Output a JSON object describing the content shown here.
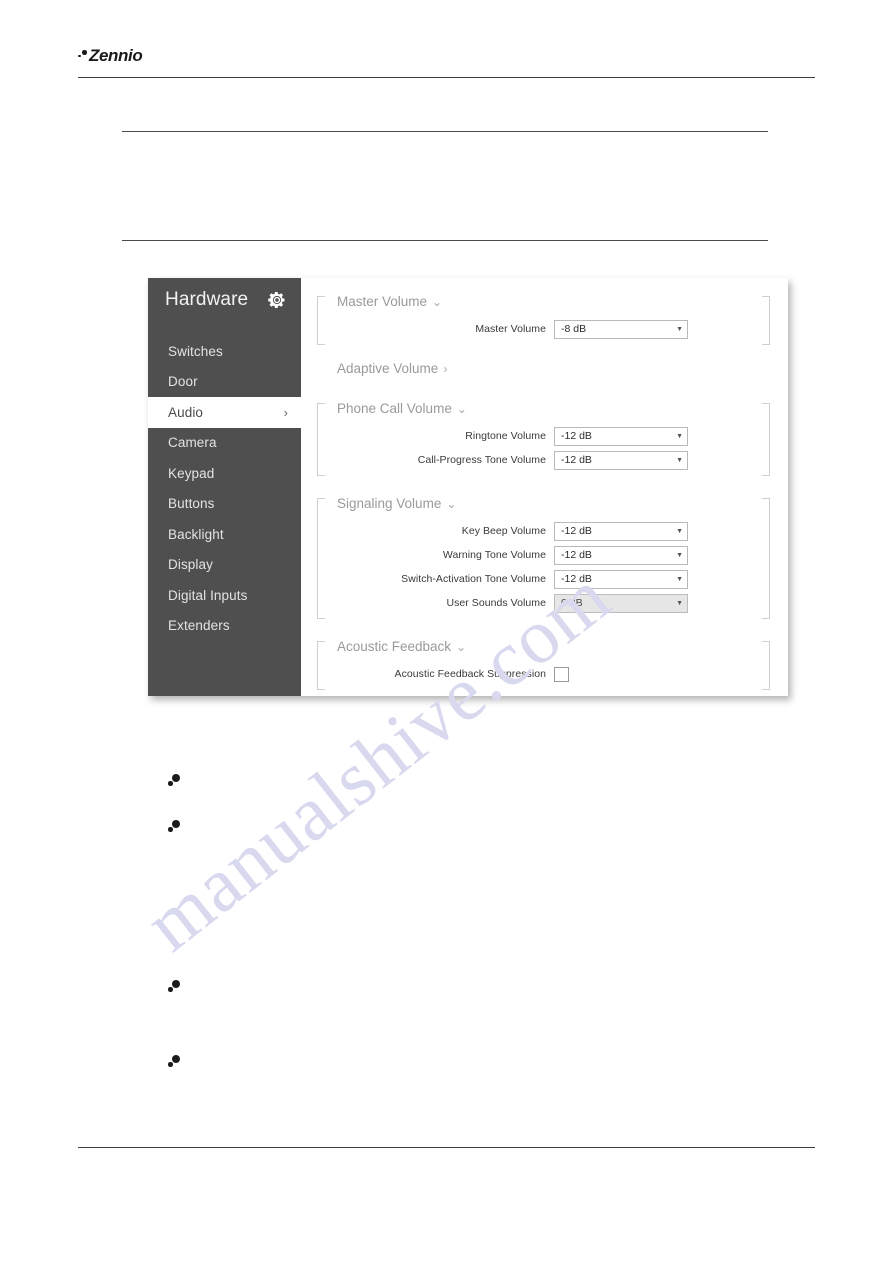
{
  "document": {
    "brand": "Zennio"
  },
  "watermark": {
    "text": "manualshive.com"
  },
  "app": {
    "sidebar": {
      "title": "Hardware",
      "gear_icon": "gear-icon",
      "items": [
        {
          "label": "Switches",
          "active": false,
          "chevron": ""
        },
        {
          "label": "Door",
          "active": false,
          "chevron": ""
        },
        {
          "label": "Audio",
          "active": true,
          "chevron": "›"
        },
        {
          "label": "Camera",
          "active": false,
          "chevron": ""
        },
        {
          "label": "Keypad",
          "active": false,
          "chevron": ""
        },
        {
          "label": "Buttons",
          "active": false,
          "chevron": ""
        },
        {
          "label": "Backlight",
          "active": false,
          "chevron": ""
        },
        {
          "label": "Display",
          "active": false,
          "chevron": ""
        },
        {
          "label": "Digital Inputs",
          "active": false,
          "chevron": ""
        },
        {
          "label": "Extenders",
          "active": false,
          "chevron": ""
        }
      ]
    },
    "groups": {
      "master": {
        "title": "Master Volume",
        "chevron": "⌄",
        "fields": [
          {
            "label": "Master Volume",
            "value": "-8 dB",
            "disabled": false
          }
        ]
      },
      "adaptive": {
        "title": "Adaptive Volume",
        "chevron": "›"
      },
      "phone": {
        "title": "Phone Call Volume",
        "chevron": "⌄",
        "fields": [
          {
            "label": "Ringtone Volume",
            "value": "-12 dB",
            "disabled": false
          },
          {
            "label": "Call-Progress Tone Volume",
            "value": "-12 dB",
            "disabled": false
          }
        ]
      },
      "signaling": {
        "title": "Signaling Volume",
        "chevron": "⌄",
        "fields": [
          {
            "label": "Key Beep Volume",
            "value": "-12 dB",
            "disabled": false
          },
          {
            "label": "Warning Tone Volume",
            "value": "-12 dB",
            "disabled": false
          },
          {
            "label": "Switch-Activation Tone Volume",
            "value": "-12 dB",
            "disabled": false
          },
          {
            "label": "User Sounds Volume",
            "value": "0 dB",
            "disabled": true
          }
        ]
      },
      "acoustic": {
        "title": "Acoustic Feedback",
        "chevron": "⌄",
        "checkbox": {
          "label": "Acoustic Feedback Suppression",
          "checked": false
        }
      }
    },
    "select_arrow": "▼"
  }
}
